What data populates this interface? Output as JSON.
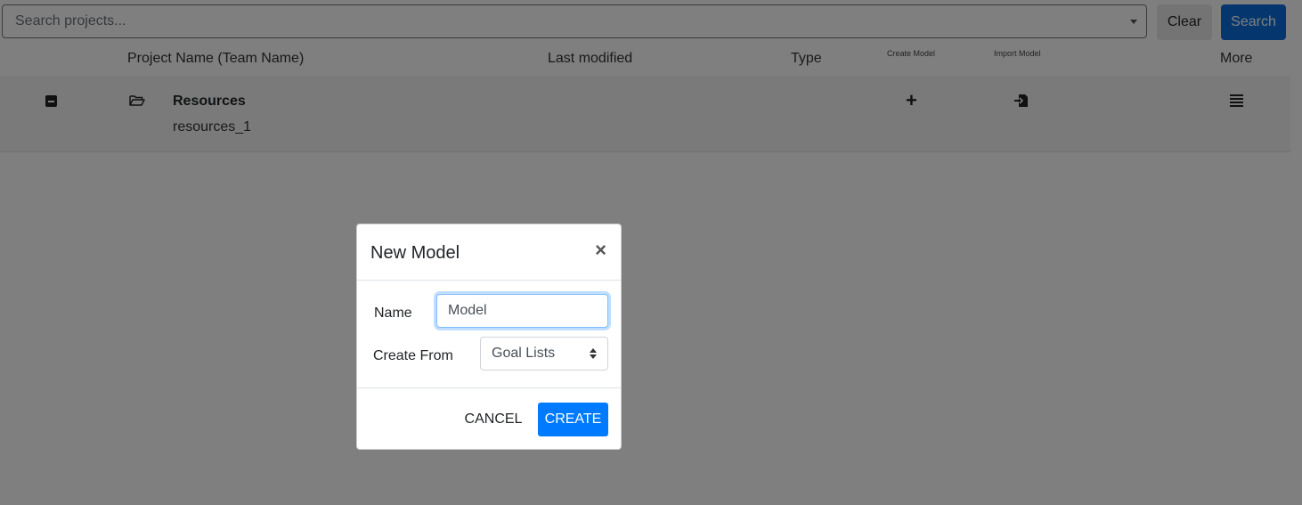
{
  "search": {
    "placeholder": "Search projects...",
    "clear_label": "Clear",
    "search_label": "Search"
  },
  "columns": {
    "project_name": "Project Name (Team Name)",
    "last_modified": "Last modified",
    "type": "Type",
    "create_model": "Create Model",
    "import_model": "Import Model",
    "more": "More"
  },
  "project_row": {
    "name": "Resources",
    "team": "resources_1",
    "icons": [
      "collapse-icon",
      "folder-open-icon",
      "plus-icon",
      "import-icon",
      "menu-icon"
    ]
  },
  "modal": {
    "title": "New Model",
    "close_symbol": "×",
    "name_label": "Name",
    "name_value": "Model",
    "create_from_label": "Create From",
    "create_from_value": "Goal Lists",
    "cancel_label": "CANCEL",
    "create_label": "CREATE"
  },
  "colors": {
    "primary": "#007bff",
    "search_button": "#0b6fdc",
    "backdrop": "rgba(0,0,0,0.5)"
  }
}
